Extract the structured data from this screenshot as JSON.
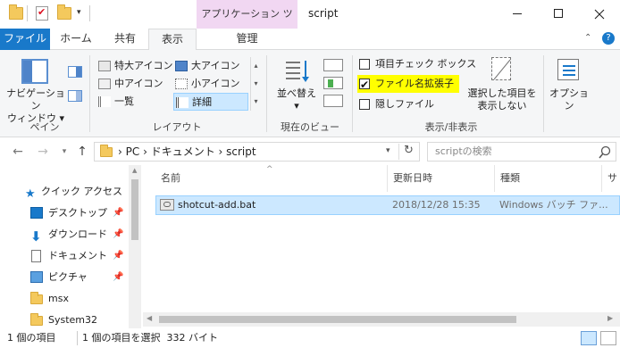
{
  "window": {
    "title": "script",
    "context_tab_label": "アプリケーション ツール",
    "buttons": {
      "minimize": "—",
      "maximize": "☐",
      "close": "✕"
    }
  },
  "ribbon_tabs": {
    "file": "ファイル",
    "home": "ホーム",
    "share": "共有",
    "view": "表示",
    "manage": "管理"
  },
  "ribbon": {
    "pane": {
      "nav_pane_label_line1": "ナビゲーション",
      "nav_pane_label_line2": "ウィンドウ",
      "group_label": "ペイン"
    },
    "layout": {
      "items": [
        "特大アイコン",
        "大アイコン",
        "中アイコン",
        "小アイコン",
        "一覧",
        "詳細"
      ],
      "selected": "詳細",
      "group_label": "レイアウト"
    },
    "current_view": {
      "sort_label": "並べ替え",
      "group_label": "現在のビュー"
    },
    "show_hide": {
      "item_checkboxes": {
        "label": "項目チェック ボックス",
        "checked": false
      },
      "file_extensions": {
        "label": "ファイル名拡張子",
        "checked": true,
        "highlight": "#ffff00"
      },
      "hidden_items": {
        "label": "隠しファイル",
        "checked": false
      },
      "hide_selected_line1": "選択した項目を",
      "hide_selected_line2": "表示しない",
      "group_label": "表示/非表示"
    },
    "options_label": "オプション"
  },
  "address": {
    "path": [
      "PC",
      "ドキュメント",
      "script"
    ],
    "search_placeholder": "scriptの検索"
  },
  "nav_pane": {
    "items": [
      {
        "label": "クイック アクセス",
        "icon": "star-icon",
        "pinned": false
      },
      {
        "label": "デスクトップ",
        "icon": "desktop-icon",
        "pinned": true
      },
      {
        "label": "ダウンロード",
        "icon": "download-icon",
        "pinned": true
      },
      {
        "label": "ドキュメント",
        "icon": "document-icon",
        "pinned": true
      },
      {
        "label": "ピクチャ",
        "icon": "picture-icon",
        "pinned": true
      },
      {
        "label": "msx",
        "icon": "folder-icon",
        "pinned": false
      },
      {
        "label": "System32",
        "icon": "folder-icon",
        "pinned": false
      }
    ]
  },
  "file_list": {
    "columns": [
      "名前",
      "更新日時",
      "種類",
      "サイ"
    ],
    "rows": [
      {
        "name": "shotcut-add.bat",
        "modified": "2018/12/28 15:35",
        "type": "Windows バッチ ファ..."
      }
    ]
  },
  "status": {
    "count": "1 個の項目",
    "selected": "1 個の項目を選択  332 バイト"
  },
  "colors": {
    "accent": "#1979ca",
    "selection": "#cce8ff",
    "context_tab": "#f1d7f2"
  }
}
